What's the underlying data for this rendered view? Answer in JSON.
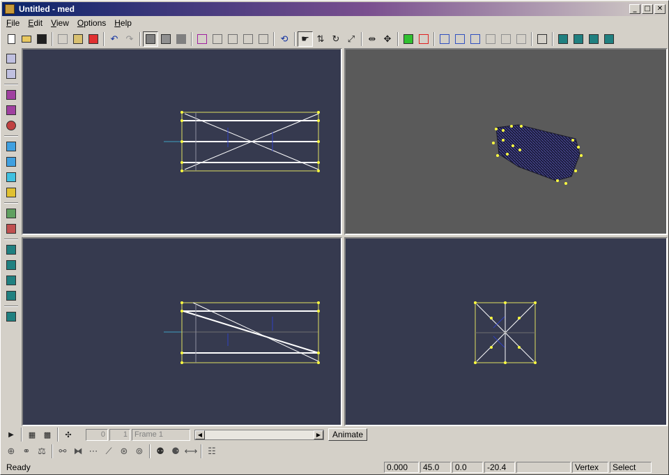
{
  "window": {
    "title": "Untitled - med"
  },
  "titlebar_buttons": {
    "minimize": "_",
    "maximize": "□",
    "close": "✕"
  },
  "menu": [
    "File",
    "Edit",
    "View",
    "Options",
    "Help"
  ],
  "animation": {
    "start_frame": "0",
    "end_frame": "1",
    "frame_label": "Frame 1",
    "animate_label": "Animate"
  },
  "status": {
    "message": "Ready",
    "x": "0.000",
    "y": "45.0",
    "z": "0.0",
    "w": "-20.4",
    "blank": "",
    "mode": "Vertex",
    "tool": "Select"
  },
  "colors": {
    "viewport_bg": "#363a4f",
    "viewport_3d_bg": "#5a5a5a",
    "wire": "#ffffff",
    "vertex": "#ffff40",
    "axis": "#3040c0"
  }
}
